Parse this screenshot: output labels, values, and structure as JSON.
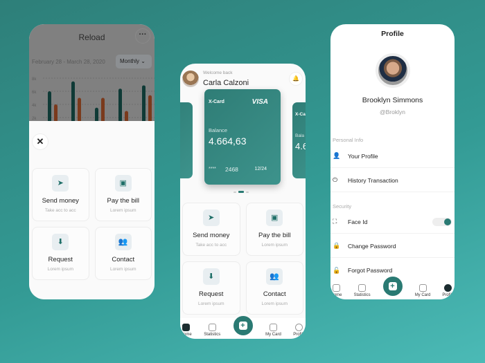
{
  "reload_screen": {
    "title": "Reload",
    "more_icon": "more-icon",
    "date_range": "February 28 - March 28, 2020",
    "period_select": "Monthly",
    "chart_data": {
      "type": "bar",
      "title": "",
      "y_ticks": [
        "8k",
        "6k",
        "4k",
        "2k"
      ],
      "ylim": [
        0,
        8000
      ],
      "grid": true,
      "series": [
        {
          "name": "series-1",
          "color": "#0f3a36",
          "values": [
            6000,
            7500,
            3500,
            6400,
            6900
          ]
        },
        {
          "name": "series-2",
          "color": "#7a3a1c",
          "values": [
            4000,
            5000,
            5000,
            3000,
            5400
          ]
        }
      ]
    },
    "actions": [
      {
        "icon": "send-icon",
        "title": "Send money",
        "subtitle": "Take acc to acc"
      },
      {
        "icon": "wallet-icon",
        "title": "Pay the bill",
        "subtitle": "Lorem ipsum"
      },
      {
        "icon": "request-icon",
        "title": "Request",
        "subtitle": "Lorem ipsum"
      },
      {
        "icon": "contact-icon",
        "title": "Contact",
        "subtitle": "Lorem ipsum"
      }
    ]
  },
  "home_screen": {
    "welcome": "Welcome back",
    "user_name": "Carla Calzoni",
    "card": {
      "name": "X-Card",
      "brand": "VISA",
      "balance_label": "Balance",
      "balance": "4.664,63",
      "masked": "****",
      "last4": "2468",
      "expiry": "12/24"
    },
    "side_card": {
      "name": "X-Ca",
      "balance_label": "Bala",
      "balance": "4.6"
    },
    "actions": [
      {
        "title": "Send money",
        "subtitle": "Take acc to acc"
      },
      {
        "title": "Pay the bill",
        "subtitle": "Lorem ipsum"
      },
      {
        "title": "Request",
        "subtitle": "Lorem ipsum"
      },
      {
        "title": "Contact",
        "subtitle": "Lorem ipsum"
      }
    ],
    "tabs": [
      "Home",
      "Statistics",
      "My Card",
      "Profile"
    ]
  },
  "profile_screen": {
    "title": "Profile",
    "name": "Brooklyn Simmons",
    "handle": "@Broklyn",
    "personal_label": "Personal Info",
    "items": [
      "Your Profile",
      "History Transaction"
    ],
    "security_label": "Security",
    "face_id": "Face Id",
    "face_id_on": true,
    "security_items": [
      "Change Password",
      "Forgot Password"
    ],
    "tabs": [
      "Home",
      "Statistics",
      "My Card",
      "Profile"
    ]
  }
}
